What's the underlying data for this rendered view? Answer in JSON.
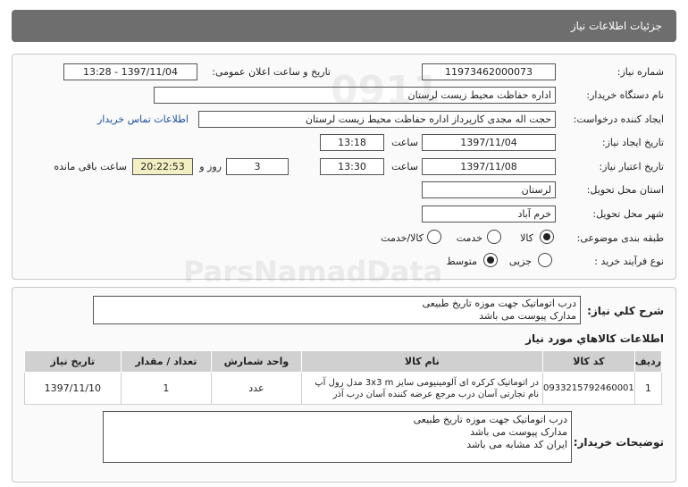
{
  "header": {
    "title": "جزئیات اطلاعات نیاز"
  },
  "form": {
    "need_number_label": "شماره نیاز:",
    "need_number": "11973462000073",
    "announce_label": "تاریخ و ساعت اعلان عمومی:",
    "announce_value": "1397/11/04 - 13:28",
    "buyer_org_label": "نام دستگاه خریدار:",
    "buyer_org": "اداره حفاظت محیط زیست لرستان",
    "requester_label": "ایجاد کننده درخواست:",
    "requester": "حجت اله مجدی کارپرداز اداره حفاظت محیط زیست لرستان",
    "contact_link": "اطلاعات تماس خریدار",
    "created_label": "تاریخ ایجاد نیاز:",
    "created_date": "1397/11/04",
    "time_label": "ساعت",
    "created_time": "13:18",
    "validity_label": "تاریخ اعتبار نیاز:",
    "validity_date": "1397/11/08",
    "validity_time": "13:30",
    "days_value": "3",
    "days_label": "روز و",
    "remaining_time": "20:22:53",
    "remaining_label": "ساعت باقی مانده",
    "province_label": "استان محل تحویل:",
    "province": "لرستان",
    "city_label": "شهر محل تحویل:",
    "city": "خرم آباد",
    "category_label": "طبقه بندی موضوعی:",
    "category_options": [
      "کالا",
      "خدمت",
      "کالا/خدمت"
    ],
    "process_label": "نوع فرآیند خرید :",
    "process_options": [
      "جزیی",
      "متوسط"
    ]
  },
  "summary": {
    "label": "شرح کلي نياز:",
    "line1": "درب اتوماتیک جهت موزه تاریخ طبیعی",
    "line2": "مدارک پیوست می باشد"
  },
  "goods": {
    "section_title": "اطلاعات کالاهاي مورد نياز",
    "columns": [
      "ردیف",
      "کد کالا",
      "نام کالا",
      "واحد شمارش",
      "تعداد / مقدار",
      "تاریخ نیاز"
    ],
    "rows": [
      {
        "index": "1",
        "code": "0933215792460001",
        "name": "در اتوماتیک کرکره ای آلومینیومی سایز 3x3 m مدل رول آپ نام تجارتی آسان درب مرجع عرضه کننده آسان درب آذر",
        "unit": "عدد",
        "qty": "1",
        "date": "1397/11/10"
      }
    ]
  },
  "buyer_notes": {
    "label": "توضیحات خریدار:",
    "line1": "درب اتوماتیک جهت موزه تاریخ طبیعی",
    "line2": "مدارک پیوست می باشد",
    "line3": "ایران کد مشابه می باشد"
  }
}
